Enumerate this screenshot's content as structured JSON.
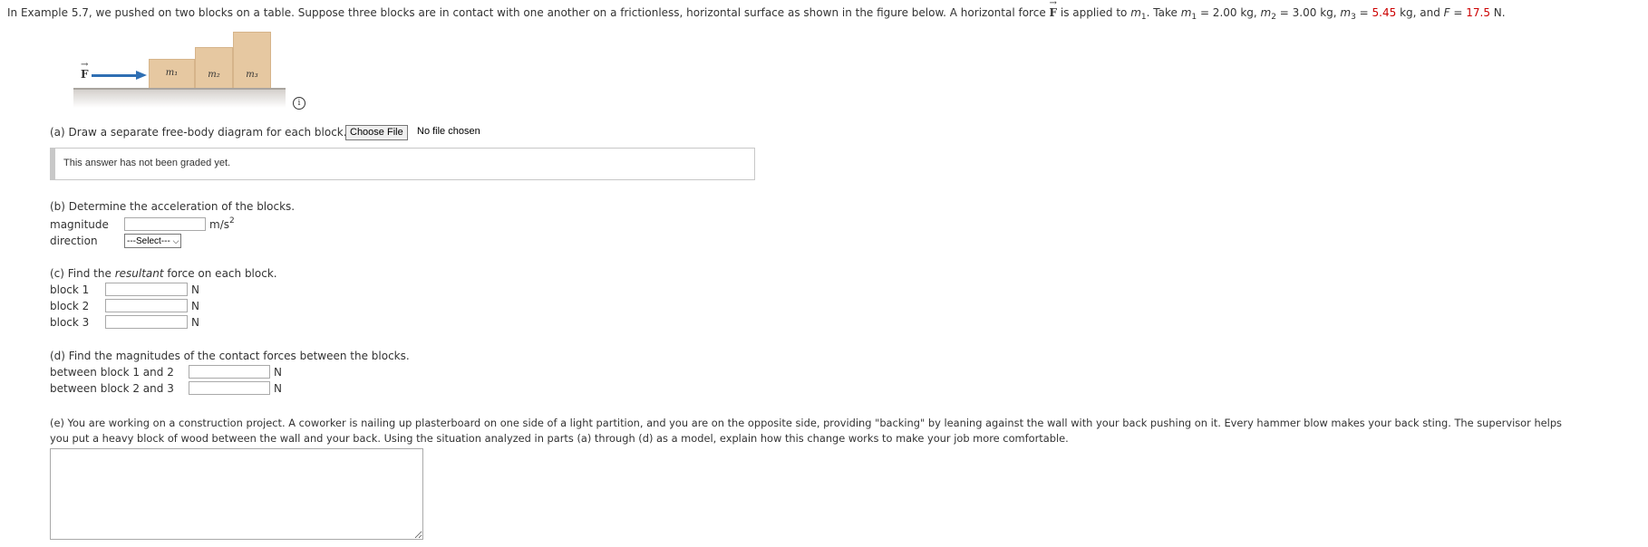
{
  "intro": {
    "p1": "In Example 5.7, we pushed on two blocks on a table. Suppose three blocks are in contact with one another on a frictionless, horizontal surface as shown in the figure below. A horizontal force ",
    "force_symbol": "F",
    "p2": " is applied to ",
    "m1": "m",
    "p3": ". Take ",
    "m1_eq": " = 2.00 kg, ",
    "m2_eq": " = 3.00 kg, ",
    "m3_eq_prefix": " = ",
    "m3_value": "5.45",
    "m3_unit": " kg, and ",
    "F_label": "F",
    "F_eq": " = ",
    "F_value": "17.5",
    "F_unit": " N.",
    "sub1": "1",
    "sub2": "2",
    "sub3": "3",
    "m_sym": "m"
  },
  "figure": {
    "force_label": "F",
    "block1": "m₁",
    "block2": "m₂",
    "block3": "m₃",
    "info_icon": "i",
    "arrow_color": "#2f6fb3",
    "block_color": "#e6c8a1"
  },
  "part_a": {
    "prompt": "(a) Draw a separate free-body diagram for each block.",
    "button": "Choose File",
    "file_status": "No file chosen",
    "graded_msg": "This answer has not been graded yet."
  },
  "part_b": {
    "prompt": "(b) Determine the acceleration of the blocks.",
    "magnitude_label": "magnitude",
    "unit": "m/s",
    "unit_exp": "2",
    "direction_label": "direction",
    "select_value": "---Select---"
  },
  "part_c": {
    "prompt_pre": "(c) Find the ",
    "prompt_em": "resultant",
    "prompt_post": " force on each block.",
    "rows": [
      {
        "label": "block 1",
        "unit": "N"
      },
      {
        "label": "block 2",
        "unit": "N"
      },
      {
        "label": "block 3",
        "unit": "N"
      }
    ]
  },
  "part_d": {
    "prompt": "(d) Find the magnitudes of the contact forces between the blocks.",
    "rows": [
      {
        "label": "between block 1 and 2",
        "unit": "N"
      },
      {
        "label": "between block 2 and 3",
        "unit": "N"
      }
    ]
  },
  "part_e": {
    "line1": "(e) You are working on a construction project. A coworker is nailing up plasterboard on one side of a light partition, and you are on the opposite side, providing \"backing\" by leaning against the wall with your back pushing on it. Every hammer blow makes your back sting. The supervisor helps",
    "line2": "you put a heavy block of wood between the wall and your back. Using the situation analyzed in parts (a) through (d) as a model, explain how this change works to make your job more comfortable."
  }
}
